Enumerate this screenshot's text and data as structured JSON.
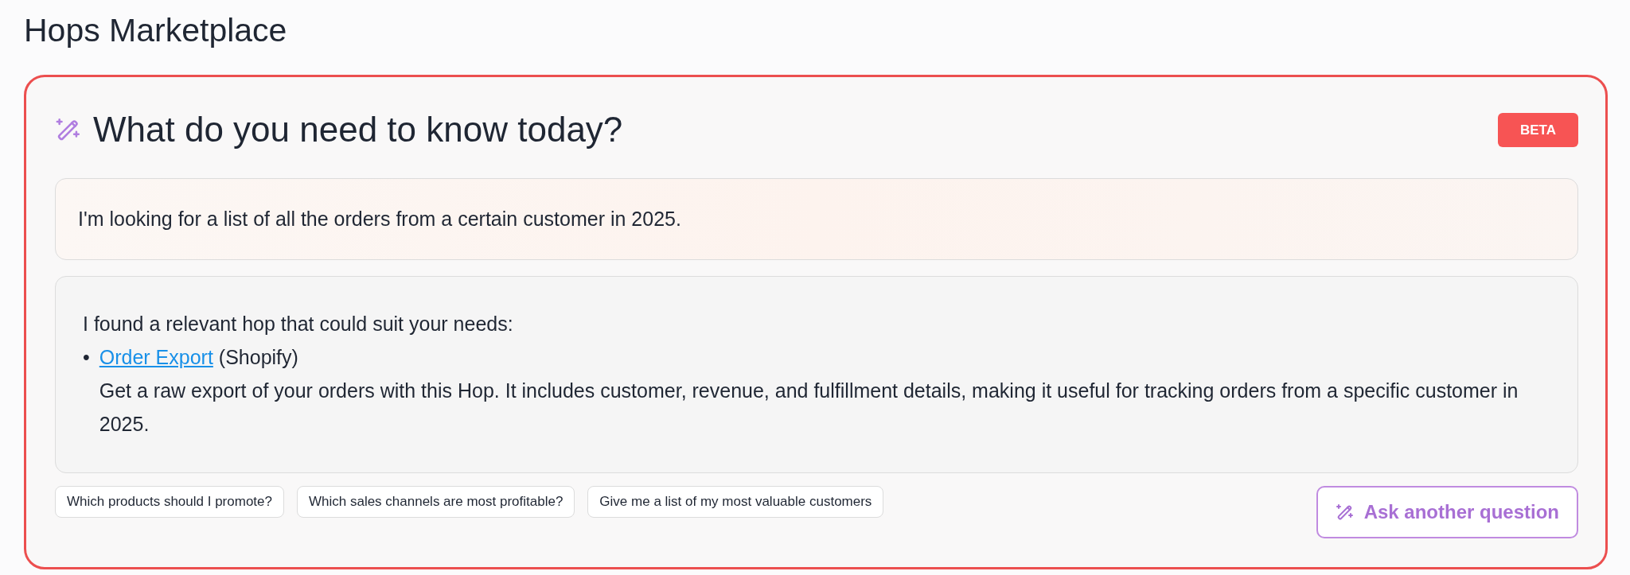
{
  "page_title": "Hops Marketplace",
  "assistant": {
    "title": "What do you need to know today?",
    "badge": "BETA",
    "question": "I'm looking for a list of all the orders from a certain customer in 2025.",
    "answer": {
      "intro": "I found a relevant hop that could suit your needs:",
      "items": [
        {
          "marker": "•",
          "link": "Order Export",
          "source": "(Shopify)",
          "description": "Get a raw export of your orders with this Hop. It includes customer, revenue, and fulfillment details, making it useful for tracking orders from a specific customer in 2025."
        }
      ]
    },
    "suggestions": [
      "Which products should I promote?",
      "Which sales channels are most profitable?",
      "Give me a list of my most valuable customers"
    ],
    "ask_button": "Ask another question"
  }
}
